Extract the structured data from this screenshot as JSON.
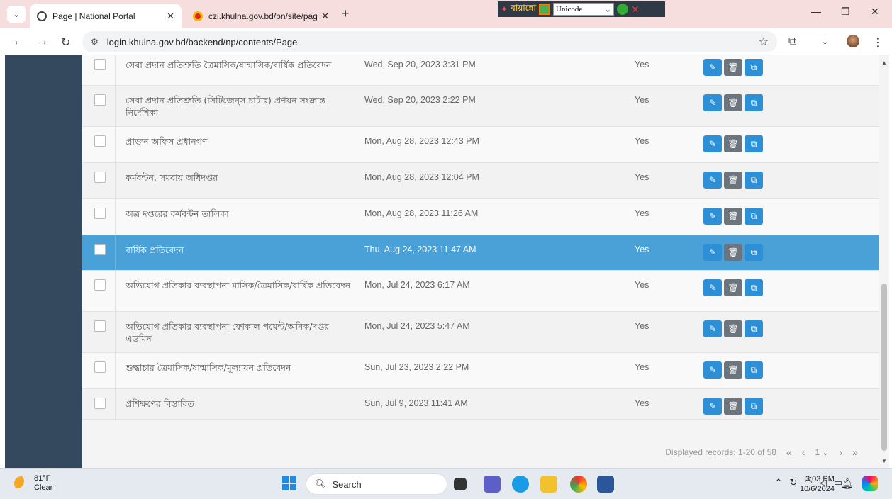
{
  "browser": {
    "tabs": [
      {
        "title": "Page | National Portal",
        "active": true
      },
      {
        "title": "czi.khulna.gov.bd/bn/site/page",
        "active": false
      }
    ],
    "url": "login.khulna.gov.bd/backend/np/contents/Page",
    "ime": {
      "brand": "বায়ান্নো",
      "encoding": "Unicode"
    }
  },
  "rows": [
    {
      "title": "সেবা প্রদান প্রতিশ্রুতি ত্রৈমাসিক/ষান্মাসিক/বার্ষিক প্রতিবেদন",
      "date": "Wed, Sep 20, 2023 3:31 PM",
      "published": "Yes",
      "selected": false
    },
    {
      "title": "সেবা প্রদান প্রতিশ্রুতি (সিটিজেন্‌স চার্টার) প্রণয়ন সংক্রান্ত নির্দেশিকা",
      "date": "Wed, Sep 20, 2023 2:22 PM",
      "published": "Yes",
      "selected": false
    },
    {
      "title": "প্রাক্তন অফিস প্রধানগণ",
      "date": "Mon, Aug 28, 2023 12:43 PM",
      "published": "Yes",
      "selected": false
    },
    {
      "title": "কর্মবন্টন, সমবায় অধিদপ্তর",
      "date": "Mon, Aug 28, 2023 12:04 PM",
      "published": "Yes",
      "selected": false
    },
    {
      "title": "অত্র দপ্তরের কর্মবন্টন তালিকা",
      "date": "Mon, Aug 28, 2023 11:26 AM",
      "published": "Yes",
      "selected": false
    },
    {
      "title": "বার্ষিক প্রতিবেদন",
      "date": "Thu, Aug 24, 2023 11:47 AM",
      "published": "Yes",
      "selected": true
    },
    {
      "title": "অভিযোগ প্রতিকার ব্যবস্থাপনা মাসিক/ত্রৈমাসিক/বার্ষিক প্রতিবেদন",
      "date": "Mon, Jul 24, 2023 6:17 AM",
      "published": "Yes",
      "selected": false
    },
    {
      "title": "অভিযোগ প্রতিকার ব্যবস্থাপনা ফোকাল পয়েন্ট/অনিক/দপ্তর এডমিন",
      "date": "Mon, Jul 24, 2023 5:47 AM",
      "published": "Yes",
      "selected": false
    },
    {
      "title": "শুদ্ধাচার ত্রৈমাসিক/ষান্মাসিক/মূল্যায়ন প্রতিবেদন",
      "date": "Sun, Jul 23, 2023 2:22 PM",
      "published": "Yes",
      "selected": false
    },
    {
      "title": "প্রশিক্ষণের বিস্তারিত",
      "date": "Sun, Jul 9, 2023 11:41 AM",
      "published": "Yes",
      "selected": false
    }
  ],
  "pagination": {
    "summary": "Displayed records: 1-20 of 58",
    "current_page": "1"
  },
  "taskbar": {
    "temperature": "81°F",
    "condition": "Clear",
    "search_placeholder": "Search",
    "time": "3:03 PM",
    "date": "10/6/2024"
  },
  "colors": {
    "sidebar": "#34495e",
    "selected_row": "#4aa1d8",
    "edit_button": "#2d8fd5",
    "delete_button": "#6c757d",
    "tab_bar": "#f7dede"
  }
}
